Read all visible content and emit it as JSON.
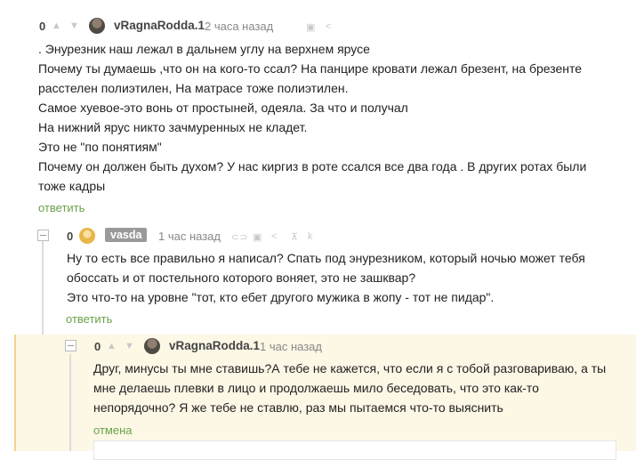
{
  "comments": [
    {
      "score": "0",
      "username": "vRagnaRodda.1",
      "time": "2 часа назад",
      "lines": [
        ". Энурезник наш лежал в дальнем углу на верхнем ярусе",
        "Почему ты думаешь ,что он на кого-то ссал? На панцире кровати лежал брезент, на брезенте",
        "расстелен полиэтилен, На матрасе тоже полиэтилен.",
        "Самое хуевое-это вонь от простыней, одеяла. За что и получал",
        "На нижний ярус никто зачмуренных не кладет.",
        "Это не \"по понятиям\"",
        "Почему он должен быть духом? У нас киргиз в роте ссался все два года . В других ротах были",
        "тоже кадры"
      ],
      "action": "ответить"
    },
    {
      "score": "0",
      "username": "vasda",
      "time": "1 час назад",
      "lines": [
        "Ну то есть все правильно я написал? Спать под энурезником, который ночью может тебя",
        "обоссать и от постельного которого воняет, это не зашквар?",
        "Это что-то на уровне \"тот, кто ебет другого мужика в жопу - тот не пидар\"."
      ],
      "action": "ответить"
    },
    {
      "score": "0",
      "username": "vRagnaRodda.1",
      "time": "1 час назад",
      "lines": [
        "Друг, минусы ты мне ставишь?А тебе не кажется, что если я с тобой разговариваю, а ты",
        "мне делаешь плевки в лицо и продолжаешь мило беседовать, что это как-то",
        "непорядочно? Я же тебе не ставлю, раз мы пытаемся что-то выяснить"
      ],
      "action": "отмена"
    }
  ],
  "icons": [
    "arrow-up-icon",
    "arrow-down-icon",
    "save-icon",
    "share-icon",
    "link-icon",
    "more-icon"
  ],
  "colors": {
    "reply": "#6aa24a",
    "highlight_bg": "#fdf7e6",
    "highlight_border": "#f2d58a",
    "tag_bg": "#9a9a9a"
  }
}
